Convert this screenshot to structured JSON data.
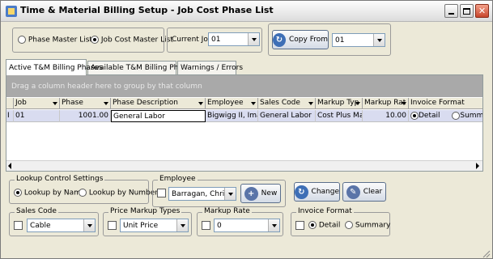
{
  "window": {
    "title": "Time & Material Billing Setup - Job Cost Phase List"
  },
  "mode": {
    "phase_master_label": "Phase Master List",
    "job_cost_master_label": "Job Cost Master List",
    "selected": "job_cost_master"
  },
  "current_job": {
    "label": "Current Job:",
    "value": "01"
  },
  "copy_from": {
    "button_label": "Copy From",
    "value": "01"
  },
  "tabs": [
    {
      "label": "Active T&M Billing Phases",
      "active": true
    },
    {
      "label": "Available T&M Billing Phases",
      "active": false
    },
    {
      "label": "Warnings / Errors",
      "active": false
    }
  ],
  "grid": {
    "group_hint": "Drag a column header here to group by that column",
    "columns": [
      "Job",
      "Phase",
      "Phase Description",
      "Employee",
      "Sales Code",
      "Markup Typ",
      "Markup Rat",
      "Invoice Format"
    ],
    "rows": [
      {
        "indicator": "I",
        "job": "01",
        "phase": "1001.00",
        "description": "General Labor",
        "employee": "Bigwigg II, Ima M",
        "sales_code": "General Labor",
        "markup_type": "Cost Plus Marku",
        "markup_rate": "10.00",
        "format_detail": "Detail",
        "format_summary": "Summar",
        "selected_format": "detail"
      }
    ]
  },
  "lookup": {
    "group_label": "Lookup Control Settings",
    "by_name_label": "Lookup by Name",
    "by_number_label": "Lookup by Number",
    "selected": "name"
  },
  "employee": {
    "group_label": "Employee",
    "value": "Barragan, Christop",
    "new_label": "New"
  },
  "actions": {
    "change_label": "Change",
    "clear_label": "Clear"
  },
  "sales_code": {
    "group_label": "Sales Code",
    "value": "Cable"
  },
  "price_markup": {
    "group_label": "Price Markup Types",
    "value": "Unit Price"
  },
  "markup_rate": {
    "group_label": "Markup Rate",
    "value": "0"
  },
  "invoice_format": {
    "group_label": "Invoice Format",
    "detail_label": "Detail",
    "summary_label": "Summary",
    "selected": "detail"
  },
  "colors": {
    "accent": "#316ac5",
    "row_highlight": "#d9dcf0",
    "group_area": "#a9a9a9",
    "close_button": "#c8452b"
  }
}
